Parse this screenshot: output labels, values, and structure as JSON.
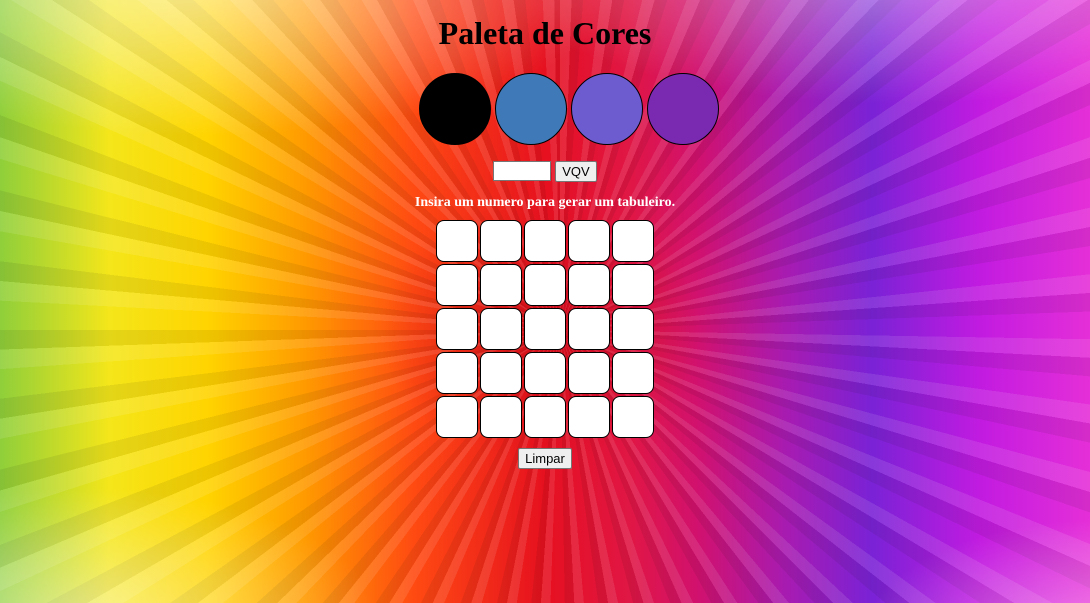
{
  "title": "Paleta de Cores",
  "palette": {
    "colors": [
      "#000000",
      "#4079b8",
      "#6d5ccf",
      "#7a2ab0"
    ]
  },
  "board_controls": {
    "size_input_value": "",
    "size_input_placeholder": "",
    "generate_button_label": "VQV",
    "hint": "Insira um numero para gerar um tabuleiro."
  },
  "board": {
    "rows": 5,
    "columns": 5,
    "pixel_color": "#ffffff"
  },
  "clear_button_label": "Limpar",
  "background": {
    "description_colors": [
      "#f4e61a",
      "#ff9a00",
      "#e6101f",
      "#a81bb0",
      "#e52fd8"
    ]
  }
}
